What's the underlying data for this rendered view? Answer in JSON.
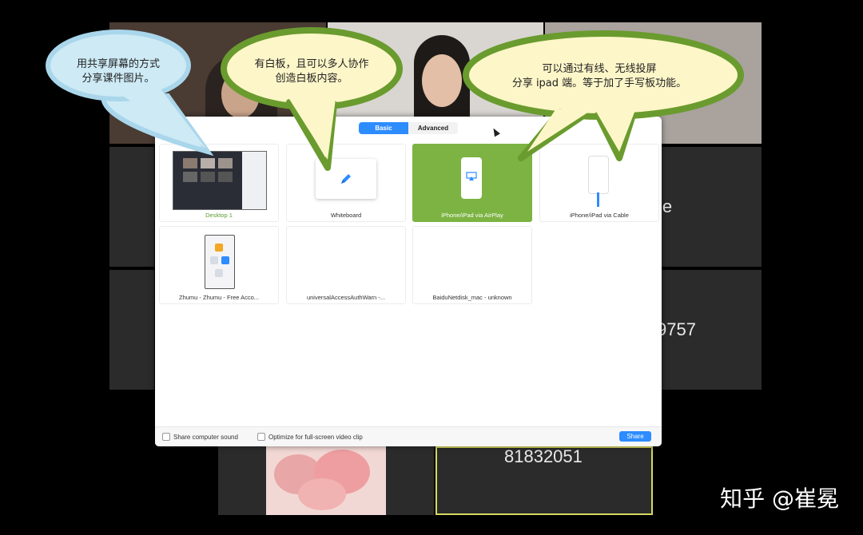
{
  "meeting": {
    "tile_numbers": [
      "ie",
      "9757",
      "81832051"
    ]
  },
  "share_dialog": {
    "tabs": [
      {
        "label": "Basic",
        "active": true
      },
      {
        "label": "Advanced",
        "active": false
      }
    ],
    "options": [
      {
        "label": "Desktop 1",
        "selected": false,
        "icon": "desktop-thumbnail"
      },
      {
        "label": "Whiteboard",
        "selected": false,
        "icon": "pen-icon"
      },
      {
        "label": "iPhone/iPad via AirPlay",
        "selected": true,
        "icon": "airplay-phone-icon"
      },
      {
        "label": "iPhone/iPad via Cable",
        "selected": false,
        "icon": "cable-phone-icon"
      },
      {
        "label": "Zhumu - Zhumu - Free Acco...",
        "selected": false,
        "icon": "app-window-thumbnail"
      },
      {
        "label": "universalAccessAuthWarn -...",
        "selected": false,
        "icon": ""
      },
      {
        "label": "BaiduNetdisk_mac - unknown",
        "selected": false,
        "icon": ""
      }
    ],
    "footer": {
      "share_sound": "Share computer sound",
      "optimize_video": "Optimize for full-screen video clip",
      "share_button": "Share"
    }
  },
  "callouts": [
    {
      "text": "用共享屏幕的方式\n分享课件图片。",
      "color": "#cdeaf5",
      "border": "#a9d6eb"
    },
    {
      "text": "有白板，且可以多人协作\n创造白板内容。",
      "color": "#fdf6c8",
      "border": "#6a9b2e"
    },
    {
      "text": "可以通过有线、无线投屏\n分享 ipad 端。等于加了手写板功能。",
      "color": "#fdf6c8",
      "border": "#6a9b2e"
    }
  ],
  "watermark": "知乎 @崔冕",
  "colors": {
    "accent": "#2d8cff",
    "selected": "#7cb342",
    "callout_border": "#6a9b2e"
  }
}
